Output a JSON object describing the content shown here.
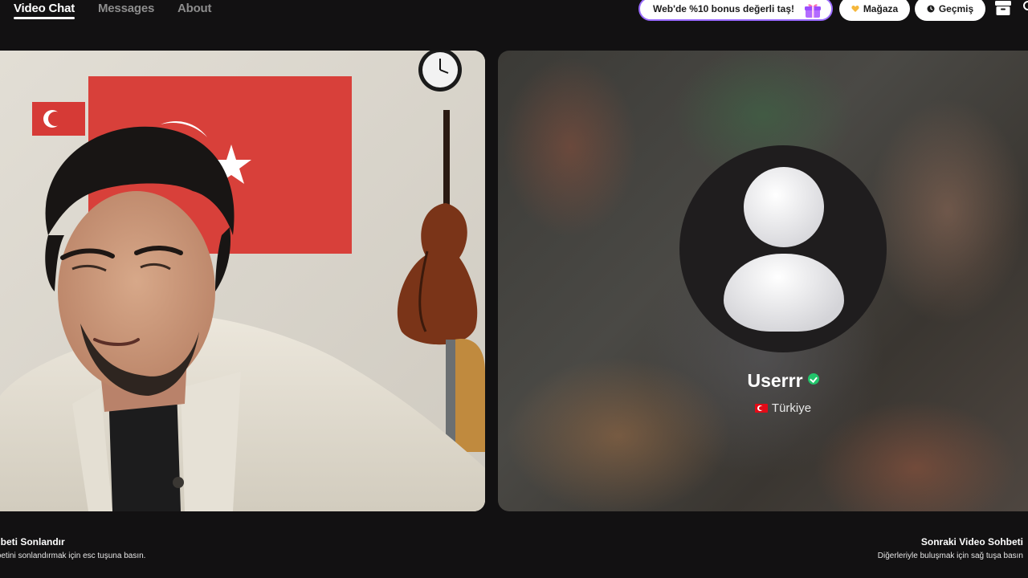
{
  "nav": {
    "tabs": [
      {
        "label": "Video Chat",
        "active": true
      },
      {
        "label": "Messages",
        "active": false
      },
      {
        "label": "About",
        "active": false
      }
    ]
  },
  "header": {
    "promo_text": "Web'de %10 bonus değerli taş!",
    "promo_icon": "gift-icon",
    "store_label": "Mağaza",
    "store_icon": "heart-icon",
    "history_label": "Geçmiş",
    "history_icon": "clock-icon",
    "inbox_icon": "archive-box-icon"
  },
  "stranger": {
    "username": "Userrr",
    "verified": true,
    "country": "Türkiye",
    "country_flag": "turkey-flag-icon"
  },
  "footer": {
    "left_title": "Sohbeti Sonlandır",
    "left_subtitle": "Sohbetini sonlandırmak için esc tuşuna basın.",
    "right_title": "Sonraki Video Sohbeti",
    "right_subtitle": "Diğerleriyle buluşmak için sağ tuşa basın"
  },
  "colors": {
    "background": "#121112",
    "promo_border": "#9a6bff",
    "verified": "#22c46b",
    "flag_red": "#e30a17"
  }
}
